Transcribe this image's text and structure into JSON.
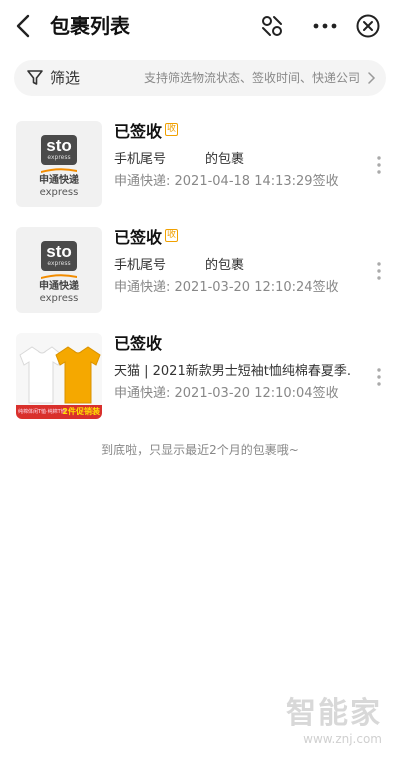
{
  "header": {
    "title": "包裹列表"
  },
  "filter": {
    "label": "筛选",
    "hint": "支持筛选物流状态、签收时间、快递公司"
  },
  "sto_logo": {
    "mark": "sto",
    "mark_sub": "express",
    "cn": "申通快递",
    "en": "express"
  },
  "packages": [
    {
      "status": "已签收",
      "badge": "收",
      "description": "手机尾号　　　的包裹",
      "meta": "申通快递: 2021-04-18 14:13:29签收"
    },
    {
      "status": "已签收",
      "badge": "收",
      "description": "手机尾号　　　的包裹",
      "meta": "申通快递: 2021-03-20 12:10:24签收"
    },
    {
      "status": "已签收",
      "description": "天猫 | 2021新款男士短袖t恤纯棉春夏季...",
      "meta": "申通快递: 2021-03-20 12:10:04签收",
      "promo_small": "纯棉体闲T恤·纯棉T恤",
      "promo_tag": "2件促销装"
    }
  ],
  "footer_note": "到底啦，只显示最近2个月的包裹哦~",
  "watermark": {
    "cn": "智能家",
    "url": "www.znj.com"
  },
  "colors": {
    "badge": "#f0a000",
    "sto_orange": "#f28c00",
    "shirt_yellow": "#f5a800",
    "promo_red": "#d9302c"
  }
}
